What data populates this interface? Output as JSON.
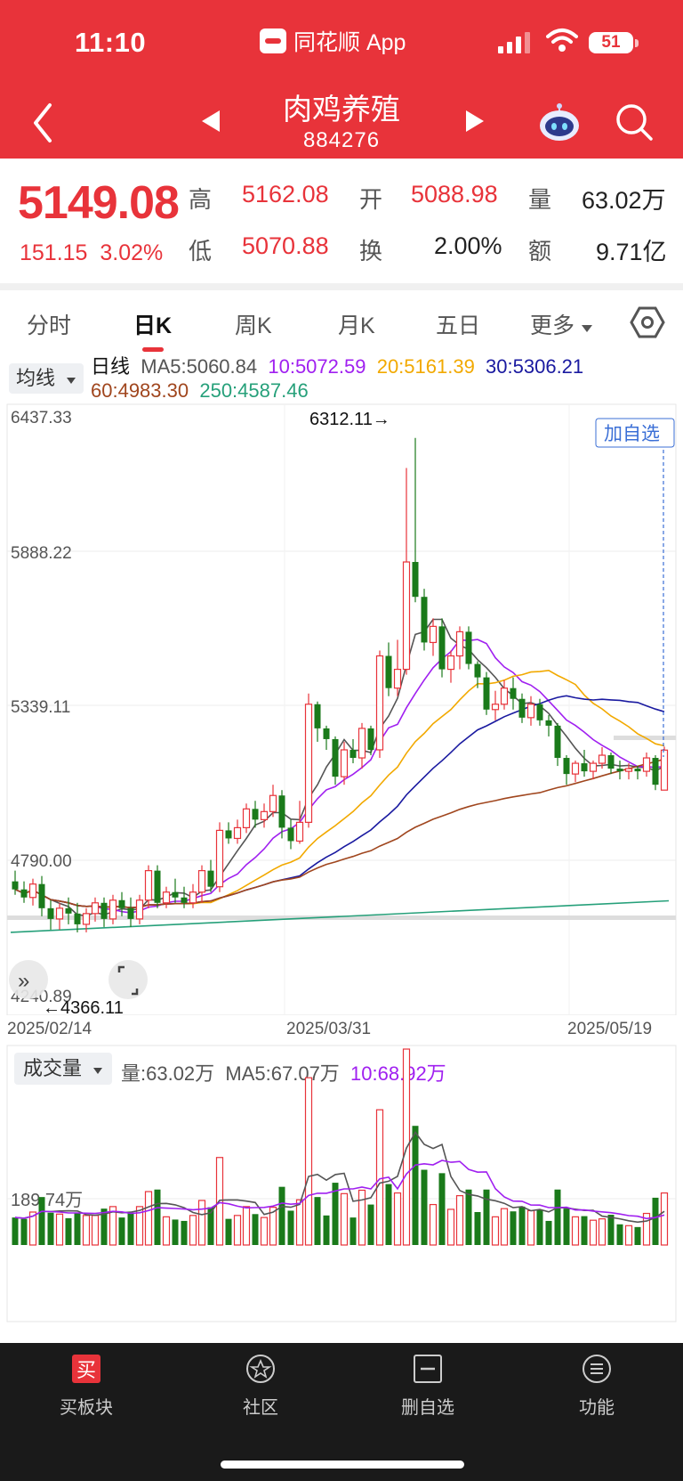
{
  "status": {
    "time": "11:10",
    "app": "同花顺 App",
    "battery": "51"
  },
  "header": {
    "title": "肉鸡养殖",
    "code": "884276"
  },
  "quote": {
    "price": "5149.08",
    "change": "151.15",
    "change_pct": "3.02%",
    "high_label": "高",
    "high": "5162.08",
    "open_label": "开",
    "open": "5088.98",
    "volume_label": "量",
    "volume": "63.02万",
    "low_label": "低",
    "low": "5070.88",
    "turnover_label": "换",
    "turnover": "2.00%",
    "amount_label": "额",
    "amount": "9.71亿"
  },
  "tabs": [
    "分时",
    "日K",
    "周K",
    "月K",
    "五日",
    "更多"
  ],
  "active_tab": "日K",
  "legend": {
    "mode": "均线",
    "kind": "日线",
    "ma5": "MA5:5060.84",
    "ma10": "10:5072.59",
    "ma20": "20:5161.39",
    "ma30": "30:5306.21",
    "ma60": "60:4983.30",
    "ma250": "250:4587.46"
  },
  "price_axis": {
    "labels": [
      "6437.33",
      "5888.22",
      "5339.11",
      "4790.00",
      "4240.89"
    ]
  },
  "annotations": {
    "high_mark": "6312.11→",
    "low_mark": "←4366.11",
    "add_watch": "加自选"
  },
  "dates": [
    "2025/02/14",
    "2025/03/31",
    "2025/05/19"
  ],
  "volume": {
    "mode": "成交量",
    "vol": "量:63.02万",
    "ma5": "MA5:67.07万",
    "ma10": "10:68.92万",
    "axis_label": "189.74万"
  },
  "nav": [
    "买板块",
    "社区",
    "删自选",
    "功能"
  ],
  "colors": {
    "up": "#e8333a",
    "down": "#1a7a1a",
    "ma5": "#555555",
    "ma10": "#a020f0",
    "ma20": "#f2a900",
    "ma30": "#1a1aa0",
    "ma60": "#a0461e",
    "ma250": "#26a07a"
  },
  "chart_data": {
    "type": "candlestick",
    "ylim": [
      4240.89,
      6437.33
    ],
    "candles": [
      [
        4660,
        4630,
        4700,
        4610
      ],
      [
        4630,
        4600,
        4660,
        4580
      ],
      [
        4600,
        4650,
        4670,
        4570
      ],
      [
        4650,
        4560,
        4680,
        4530
      ],
      [
        4560,
        4520,
        4590,
        4480
      ],
      [
        4520,
        4560,
        4580,
        4480
      ],
      [
        4560,
        4540,
        4600,
        4500
      ],
      [
        4540,
        4500,
        4580,
        4470
      ],
      [
        4500,
        4540,
        4560,
        4470
      ],
      [
        4540,
        4580,
        4600,
        4510
      ],
      [
        4580,
        4520,
        4600,
        4490
      ],
      [
        4520,
        4590,
        4610,
        4500
      ],
      [
        4590,
        4560,
        4620,
        4530
      ],
      [
        4560,
        4520,
        4600,
        4490
      ],
      [
        4520,
        4590,
        4610,
        4500
      ],
      [
        4590,
        4700,
        4720,
        4560
      ],
      [
        4700,
        4580,
        4720,
        4560
      ],
      [
        4580,
        4620,
        4640,
        4560
      ],
      [
        4620,
        4600,
        4670,
        4580
      ],
      [
        4600,
        4580,
        4640,
        4560
      ],
      [
        4580,
        4620,
        4650,
        4560
      ],
      [
        4620,
        4700,
        4720,
        4580
      ],
      [
        4700,
        4640,
        4740,
        4620
      ],
      [
        4640,
        4850,
        4880,
        4620
      ],
      [
        4850,
        4820,
        4880,
        4800
      ],
      [
        4820,
        4860,
        4890,
        4800
      ],
      [
        4860,
        4930,
        4950,
        4840
      ],
      [
        4930,
        4890,
        4960,
        4860
      ],
      [
        4890,
        4920,
        4950,
        4860
      ],
      [
        4920,
        4980,
        5020,
        4900
      ],
      [
        4980,
        4860,
        5000,
        4820
      ],
      [
        4860,
        4810,
        4890,
        4780
      ],
      [
        4810,
        4880,
        4960,
        4800
      ],
      [
        4880,
        5320,
        5360,
        4860
      ],
      [
        5320,
        5230,
        5330,
        5180
      ],
      [
        5230,
        5190,
        5240,
        5150
      ],
      [
        5190,
        5050,
        5200,
        5020
      ],
      [
        5050,
        5150,
        5180,
        5020
      ],
      [
        5150,
        5120,
        5190,
        5100
      ],
      [
        5120,
        5230,
        5250,
        5080
      ],
      [
        5230,
        5150,
        5240,
        5130
      ],
      [
        5150,
        5500,
        5520,
        5120
      ],
      [
        5500,
        5380,
        5550,
        5350
      ],
      [
        5380,
        5450,
        5560,
        5350
      ],
      [
        5450,
        5850,
        6200,
        5430
      ],
      [
        5850,
        5720,
        6312,
        5700
      ],
      [
        5720,
        5550,
        5750,
        5520
      ],
      [
        5550,
        5610,
        5640,
        5500
      ],
      [
        5610,
        5450,
        5640,
        5420
      ],
      [
        5450,
        5500,
        5520,
        5400
      ],
      [
        5500,
        5590,
        5610,
        5450
      ],
      [
        5590,
        5470,
        5610,
        5450
      ],
      [
        5470,
        5420,
        5480,
        5380
      ],
      [
        5420,
        5300,
        5440,
        5280
      ],
      [
        5300,
        5320,
        5370,
        5260
      ],
      [
        5320,
        5380,
        5410,
        5300
      ],
      [
        5380,
        5340,
        5420,
        5300
      ],
      [
        5340,
        5270,
        5360,
        5250
      ],
      [
        5270,
        5320,
        5350,
        5240
      ],
      [
        5320,
        5260,
        5340,
        5240
      ],
      [
        5260,
        5240,
        5280,
        5200
      ],
      [
        5240,
        5120,
        5250,
        5090
      ],
      [
        5120,
        5060,
        5130,
        5020
      ],
      [
        5060,
        5100,
        5110,
        5030
      ],
      [
        5100,
        5070,
        5150,
        5050
      ],
      [
        5070,
        5100,
        5110,
        5040
      ],
      [
        5100,
        5130,
        5160,
        5080
      ],
      [
        5130,
        5080,
        5140,
        5060
      ],
      [
        5080,
        5070,
        5110,
        5040
      ],
      [
        5070,
        5080,
        5100,
        5040
      ],
      [
        5080,
        5070,
        5090,
        5040
      ],
      [
        5070,
        5120,
        5140,
        5050
      ],
      [
        5120,
        5020,
        5130,
        5000
      ],
      [
        5000,
        5149.08,
        5162.08,
        5070.88
      ]
    ]
  }
}
